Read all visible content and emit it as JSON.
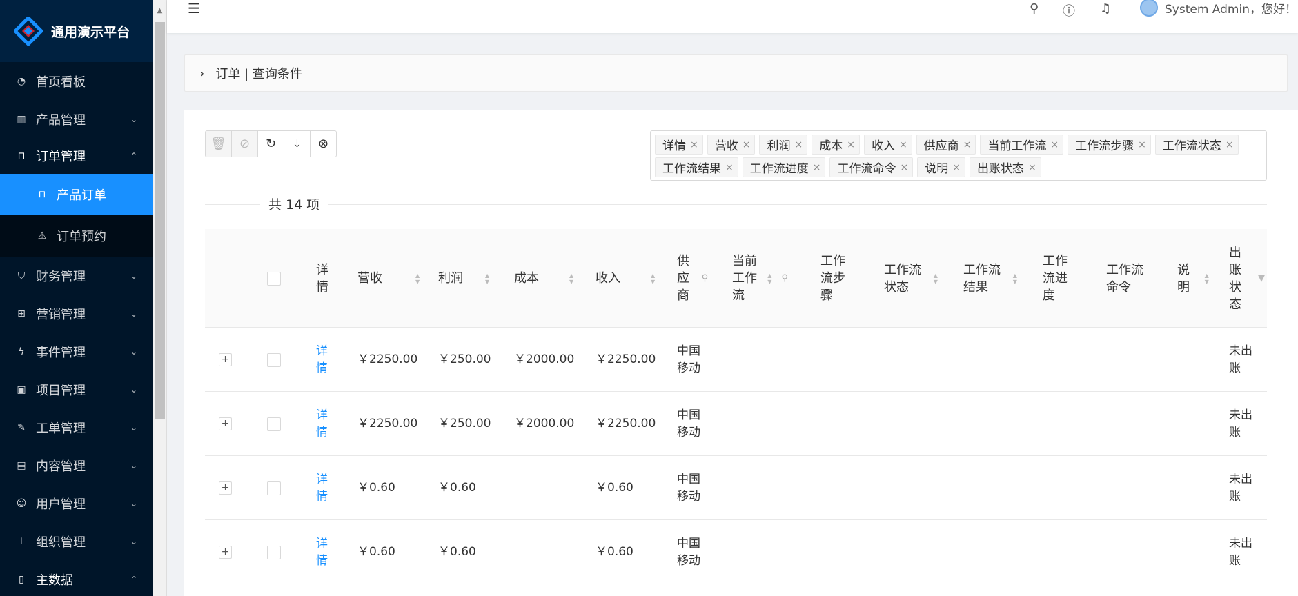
{
  "app": {
    "title": "通用演示平台"
  },
  "sidebar": {
    "items": [
      {
        "label": "首页看板",
        "icon": "dashboard-icon"
      },
      {
        "label": "产品管理",
        "icon": "barcode-icon"
      },
      {
        "label": "订单管理",
        "icon": "shopping-bag-icon",
        "open": true,
        "children": [
          {
            "label": "产品订单",
            "icon": "shopping-bag-icon",
            "active": true
          },
          {
            "label": "订单预约",
            "icon": "warning-icon"
          }
        ]
      },
      {
        "label": "财务管理",
        "icon": "shield-icon"
      },
      {
        "label": "营销管理",
        "icon": "gift-icon"
      },
      {
        "label": "事件管理",
        "icon": "thunderbolt-icon"
      },
      {
        "label": "项目管理",
        "icon": "project-icon"
      },
      {
        "label": "工单管理",
        "icon": "edit-icon"
      },
      {
        "label": "内容管理",
        "icon": "read-icon"
      },
      {
        "label": "用户管理",
        "icon": "user-icon"
      },
      {
        "label": "组织管理",
        "icon": "cluster-icon"
      },
      {
        "label": "主数据",
        "icon": "book-icon"
      }
    ]
  },
  "header": {
    "user_text": "System Admin，您好！"
  },
  "query": {
    "title": "订单 | 查询条件"
  },
  "column_tags": [
    "详情",
    "营收",
    "利润",
    "成本",
    "收入",
    "供应商",
    "当前工作流",
    "工作流步骤",
    "工作流状态",
    "工作流结果",
    "工作流进度",
    "工作流命令",
    "说明",
    "出账状态"
  ],
  "total_text": "共 14 项",
  "table": {
    "columns": [
      "详情",
      "营收",
      "利润",
      "成本",
      "收入",
      "供应商",
      "当前工作流",
      "工作流步骤",
      "工作流状态",
      "工作流结果",
      "工作流进度",
      "工作流命令",
      "说明",
      "出账状态"
    ],
    "rows": [
      {
        "detail": "详情",
        "revenue": "￥2250.00",
        "profit": "￥250.00",
        "cost": "￥2000.00",
        "income": "￥2250.00",
        "supplier": "中国移动",
        "billing": "未出账"
      },
      {
        "detail": "详情",
        "revenue": "￥2250.00",
        "profit": "￥250.00",
        "cost": "￥2000.00",
        "income": "￥2250.00",
        "supplier": "中国移动",
        "billing": "未出账"
      },
      {
        "detail": "详情",
        "revenue": "￥0.60",
        "profit": "￥0.60",
        "cost": "",
        "income": "￥0.60",
        "supplier": "中国移动",
        "billing": "未出账"
      },
      {
        "detail": "详情",
        "revenue": "￥0.60",
        "profit": "￥0.60",
        "cost": "",
        "income": "￥0.60",
        "supplier": "中国移动",
        "billing": "未出账"
      }
    ]
  },
  "colors": {
    "sidebar_bg": "#001529",
    "active": "#1890ff",
    "link": "#1890ff"
  }
}
